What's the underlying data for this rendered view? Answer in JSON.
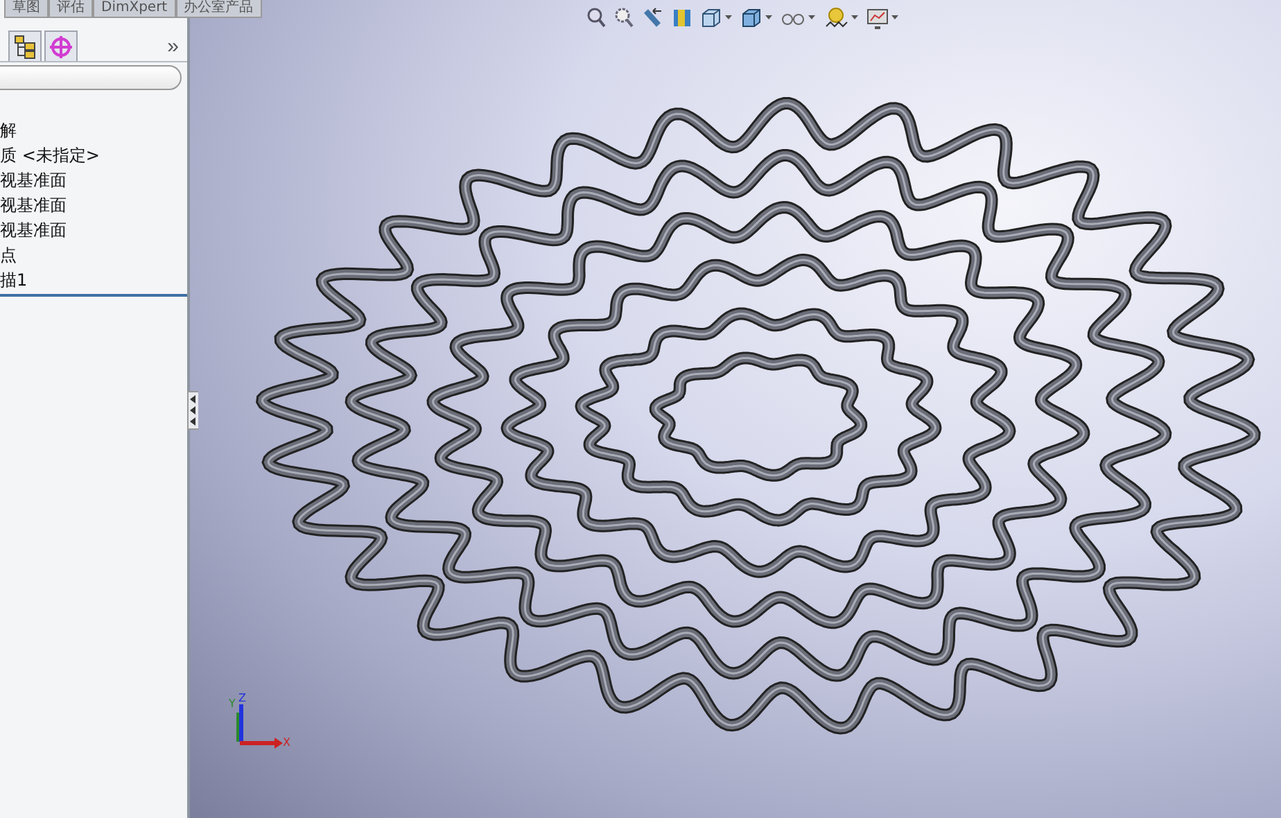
{
  "command_tabs": [
    {
      "label": "草图"
    },
    {
      "label": "评估"
    },
    {
      "label": "DimXpert"
    },
    {
      "label": "办公室产品"
    }
  ],
  "panel_tabs": [
    {
      "kind": "config"
    },
    {
      "kind": "target"
    }
  ],
  "panel_more": "»",
  "tree": [
    {
      "label": "解"
    },
    {
      "label": "质 <未指定>"
    },
    {
      "label": "视基准面"
    },
    {
      "label": "视基准面"
    },
    {
      "label": "视基准面"
    },
    {
      "label": "点"
    },
    {
      "label": "描1"
    }
  ],
  "toolbar": [
    {
      "kind": "zoom-fit",
      "dropdown": false
    },
    {
      "kind": "zoom-area",
      "dropdown": false
    },
    {
      "kind": "previous",
      "dropdown": false
    },
    {
      "kind": "section",
      "dropdown": false
    },
    {
      "kind": "orientation",
      "dropdown": true
    },
    {
      "kind": "display",
      "dropdown": true
    },
    {
      "kind": "hide",
      "dropdown": true
    },
    {
      "kind": "scene",
      "dropdown": true
    },
    {
      "kind": "render",
      "dropdown": true
    }
  ],
  "triad": {
    "y": "Y",
    "z": "Z",
    "x": "X"
  }
}
